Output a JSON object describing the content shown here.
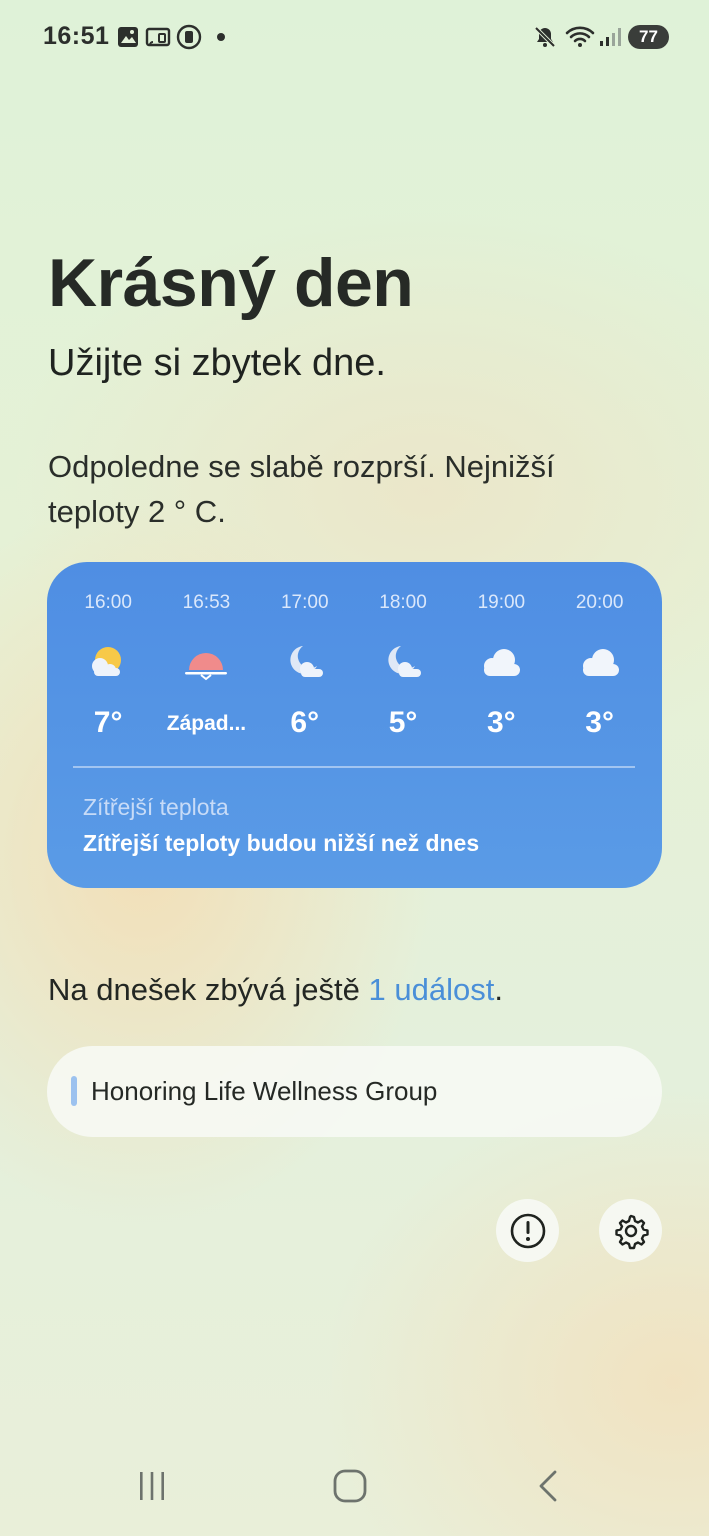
{
  "status_bar": {
    "time": "16:51",
    "battery": "77",
    "icons": [
      "gallery-icon",
      "cast-icon",
      "screen-record-icon",
      "mute-icon",
      "wifi-icon",
      "signal-icon"
    ]
  },
  "greeting": {
    "title": "Krásný den",
    "subtitle": "Užijte si zbytek dne.",
    "forecast": "Odpoledne se slabě rozprší. Nejnižší teploty 2 ° C."
  },
  "weather_card": {
    "hours": [
      {
        "time": "16:00",
        "icon": "sun-cloud-icon",
        "temp": "7°"
      },
      {
        "time": "16:53",
        "icon": "sunset-icon",
        "temp": "Západ..."
      },
      {
        "time": "17:00",
        "icon": "moon-cloud-icon",
        "temp": "6°"
      },
      {
        "time": "18:00",
        "icon": "moon-cloud-icon",
        "temp": "5°"
      },
      {
        "time": "19:00",
        "icon": "cloud-icon",
        "temp": "3°"
      },
      {
        "time": "20:00",
        "icon": "cloud-icon",
        "temp": "3°"
      }
    ],
    "tomorrow_label": "Zítřejší teplota",
    "tomorrow_text": "Zítřejší teploty budou nižší než dnes"
  },
  "events": {
    "prefix": "Na dnešek zbývá ještě ",
    "link": "1 událost",
    "suffix": ".",
    "items": [
      {
        "title": "Honoring Life Wellness Group",
        "color": "#9cc2ef"
      }
    ]
  },
  "actions": {
    "info_icon": "info-icon",
    "settings_icon": "gear-icon"
  },
  "nav": {
    "recents_icon": "recents-icon",
    "home_icon": "home-icon",
    "back_icon": "back-icon"
  },
  "colors": {
    "card": "#4f8ee3",
    "link": "#4a8fd8"
  }
}
